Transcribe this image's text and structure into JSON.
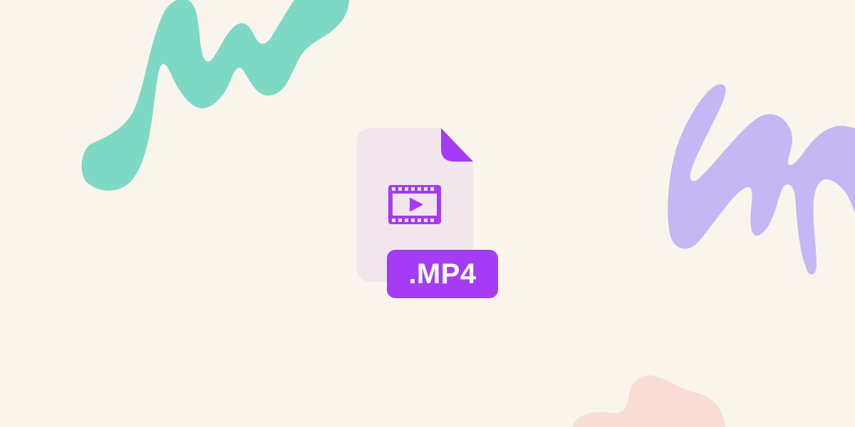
{
  "file": {
    "extension_label": ".MP4",
    "icon": "video-file-icon",
    "inner_icon": "film-play-icon"
  },
  "colors": {
    "background": "#FAF5EC",
    "file_body": "#F1E6EC",
    "accent": "#A63BF5",
    "green_blob": "#7ED9C4",
    "purple_blob": "#C3B8F3",
    "pink_blob": "#F9DCD6"
  }
}
